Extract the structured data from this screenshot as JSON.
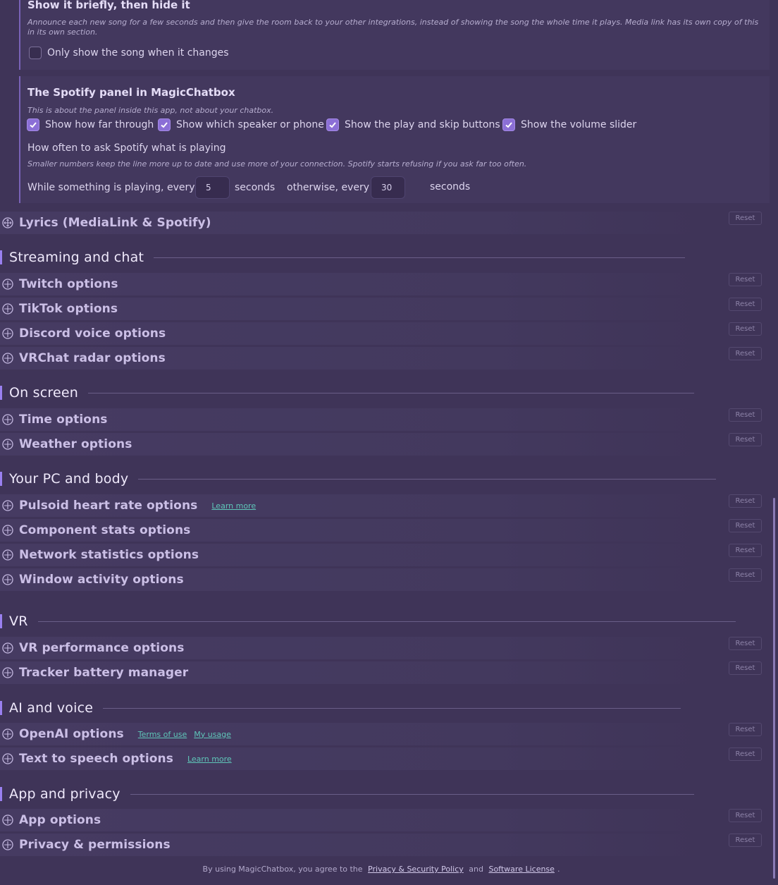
{
  "mediaLinkPanel": {
    "title": "Show it briefly, then hide it",
    "description": "Announce each new song for a few seconds and then give the room back to your other integrations, instead of showing the song the whole time it plays. Media link has its own copy of this in its own section.",
    "checkbox_label": "Only show the song when it changes",
    "checkbox_checked": false
  },
  "spotifyPanel": {
    "title": "The Spotify panel in MagicChatbox",
    "description": "This is about the panel inside this app, not about your chatbox.",
    "checkboxes": [
      {
        "label": "Show how far through",
        "checked": true
      },
      {
        "label": "Show which speaker or phone",
        "checked": true
      },
      {
        "label": "Show the play and skip buttons",
        "checked": true
      },
      {
        "label": "Show the volume slider",
        "checked": true
      }
    ],
    "poll_title": "How often to ask Spotify what is playing",
    "poll_description": "Smaller numbers keep the line more up to date and use more of your connection. Spotify starts refusing if you ask far too often.",
    "playing_label": "While something is playing, every",
    "playing_value": "5",
    "seconds_label": "seconds",
    "otherwise_label": "otherwise, every",
    "otherwise_value": "30"
  },
  "reset_label": "Reset",
  "lyricsRow": {
    "label": "Lyrics (MediaLink & Spotify)"
  },
  "sections": {
    "streaming": {
      "title": "Streaming and chat",
      "rows": [
        {
          "label": "Twitch options"
        },
        {
          "label": "TikTok options"
        },
        {
          "label": "Discord voice options"
        },
        {
          "label": "VRChat radar options"
        }
      ]
    },
    "onscreen": {
      "title": "On screen",
      "rows": [
        {
          "label": "Time options"
        },
        {
          "label": "Weather options"
        }
      ]
    },
    "pc": {
      "title": "Your PC and body",
      "rows": [
        {
          "label": "Pulsoid heart rate options",
          "links": [
            "Learn more"
          ]
        },
        {
          "label": "Component stats options"
        },
        {
          "label": "Network statistics options"
        },
        {
          "label": "Window activity options"
        }
      ]
    },
    "vr": {
      "title": "VR",
      "rows": [
        {
          "label": "VR performance options"
        },
        {
          "label": "Tracker battery manager"
        }
      ]
    },
    "ai": {
      "title": "AI and voice",
      "rows": [
        {
          "label": "OpenAI options",
          "links": [
            "Terms of use",
            "My usage"
          ]
        },
        {
          "label": "Text to speech options",
          "links": [
            "Learn more"
          ]
        }
      ]
    },
    "app": {
      "title": "App and privacy",
      "rows": [
        {
          "label": "App options"
        },
        {
          "label": "Privacy & permissions"
        }
      ]
    }
  },
  "footer": {
    "prefix": "By using MagicChatbox, you agree to the",
    "privacy_link": "Privacy & Security Policy",
    "and": "and",
    "license_link": "Software License",
    "suffix": "."
  },
  "colors": {
    "background": "#3f3458",
    "accent": "#9a80f0",
    "link": "#5fc7b9",
    "checkbox_checked": "#8b6fd6"
  },
  "icons": {
    "row_expand": "expand-arrows-icon",
    "checkbox": "checkmark-icon"
  }
}
